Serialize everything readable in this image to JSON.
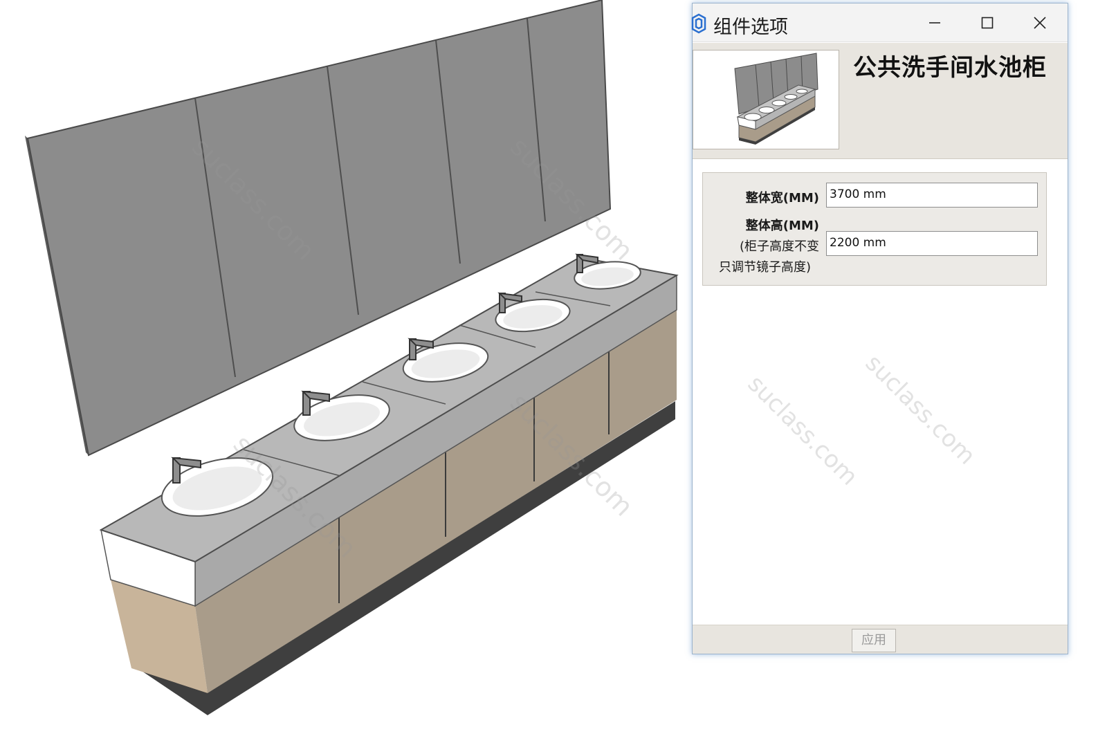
{
  "dialog": {
    "title": "组件选项",
    "component_name": "公共洗手间水池柜",
    "fields": [
      {
        "label": "整体宽(MM)",
        "value": "3700 mm"
      },
      {
        "label": "整体高(MM)",
        "note_line1": "(柜子高度不变",
        "note_line2": "只调节镜子高度)",
        "value": "2200 mm"
      }
    ],
    "apply_label": "应用"
  },
  "watermark": "suclass.com",
  "colors": {
    "mirror": "#8c8c8c",
    "countertop": "#b5b5b5",
    "cabinet_wood": "#a99c8a",
    "plinth": "#3f3f3f",
    "dialog_accent": "#5b8fd0"
  },
  "icons": {
    "app": "sketchup-icon",
    "minimize": "minimize-icon",
    "maximize": "maximize-icon",
    "close": "close-icon"
  }
}
